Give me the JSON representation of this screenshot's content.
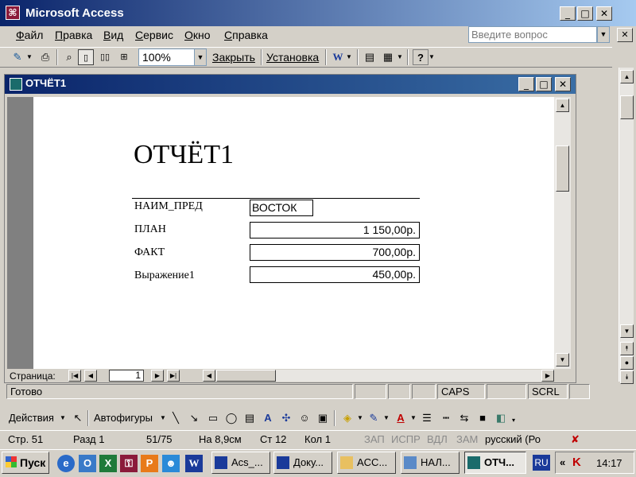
{
  "app": {
    "title": "Microsoft Access",
    "icon": "access-key-icon"
  },
  "menu": {
    "items": [
      "Файл",
      "Правка",
      "Вид",
      "Сервис",
      "Окно",
      "Справка"
    ],
    "help_placeholder": "Введите вопрос"
  },
  "toolbar": {
    "zoom": "100%",
    "close_label": "Закрыть",
    "setup_label": "Установка",
    "icons": [
      "view-icon",
      "print-icon",
      "zoom-magnifier-icon",
      "one-page-icon",
      "two-pages-icon",
      "multiple-pages-icon",
      "word-export-icon",
      "database-window-icon",
      "new-object-icon",
      "help-icon"
    ]
  },
  "report_window": {
    "title": "ОТЧЁТ1",
    "pager_label": "Страница:",
    "page_number": "1"
  },
  "report": {
    "title": "ОТЧЁТ1",
    "fields": [
      {
        "label": "НАИМ_ПРЕД",
        "value": "ВОСТОК"
      },
      {
        "label": "ПЛАН",
        "value": "1 150,00р."
      },
      {
        "label": "ФАКТ",
        "value": "700,00р."
      },
      {
        "label": "Выражение1",
        "value": "450,00р."
      }
    ]
  },
  "statusbar": {
    "ready": "Готово",
    "caps": "CAPS",
    "scrl": "SCRL"
  },
  "drawbar": {
    "actions_label": "Действия",
    "autoshapes_label": "Автофигуры"
  },
  "word_status": {
    "page": "Стр. 51",
    "section": "Разд 1",
    "pages": "51/75",
    "at": "На 8,9см",
    "line": "Ст 12",
    "col": "Кол 1",
    "rec": "ЗАП",
    "trk": "ИСПР",
    "ext": "ВДЛ",
    "ovr": "ЗАМ",
    "lang": "русский (Ро"
  },
  "taskbar": {
    "start_label": "Пуск",
    "tasks": [
      "Acs_...",
      "Доку...",
      "ACC...",
      "НАЛ...",
      "ОТЧ..."
    ],
    "lang": "RU",
    "clock": "14:17"
  }
}
